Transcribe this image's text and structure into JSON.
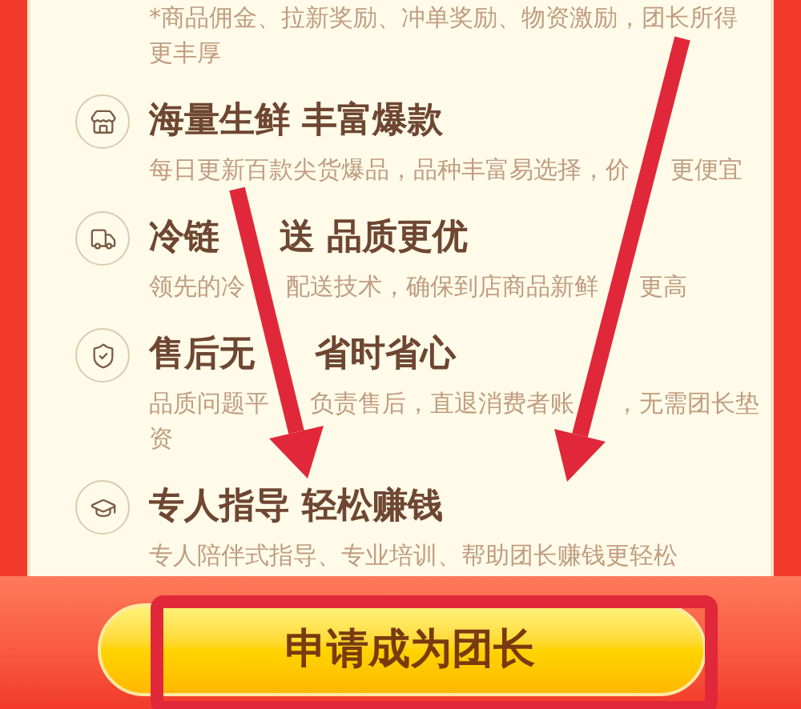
{
  "intro_text": "*商品佣金、拉新奖励、冲单奖励、物资激励，团长所得更丰厚",
  "benefits": [
    {
      "kind": "store",
      "title": [
        "海量生鲜 丰富爆款"
      ],
      "description": [
        "每日更新百款尖货爆品，品种丰富易选择，价",
        "更便宜"
      ]
    },
    {
      "kind": "truck",
      "title": [
        "冷链",
        "送 品质更优"
      ],
      "description": [
        "领先的冷",
        "配送技术，确保到店商品新鲜",
        "更高"
      ]
    },
    {
      "kind": "shield",
      "title": [
        "售后无",
        "省时省心"
      ],
      "description": [
        "品质问题平",
        "负责售后，直退消费者账",
        "，无需团长垫资"
      ]
    },
    {
      "kind": "cap",
      "title": [
        "专人指导 轻松赚钱"
      ],
      "description": [
        "专人陪伴式指导、专业培训、帮助团长赚钱更轻松"
      ]
    }
  ],
  "apply_button": "申请成为团长"
}
